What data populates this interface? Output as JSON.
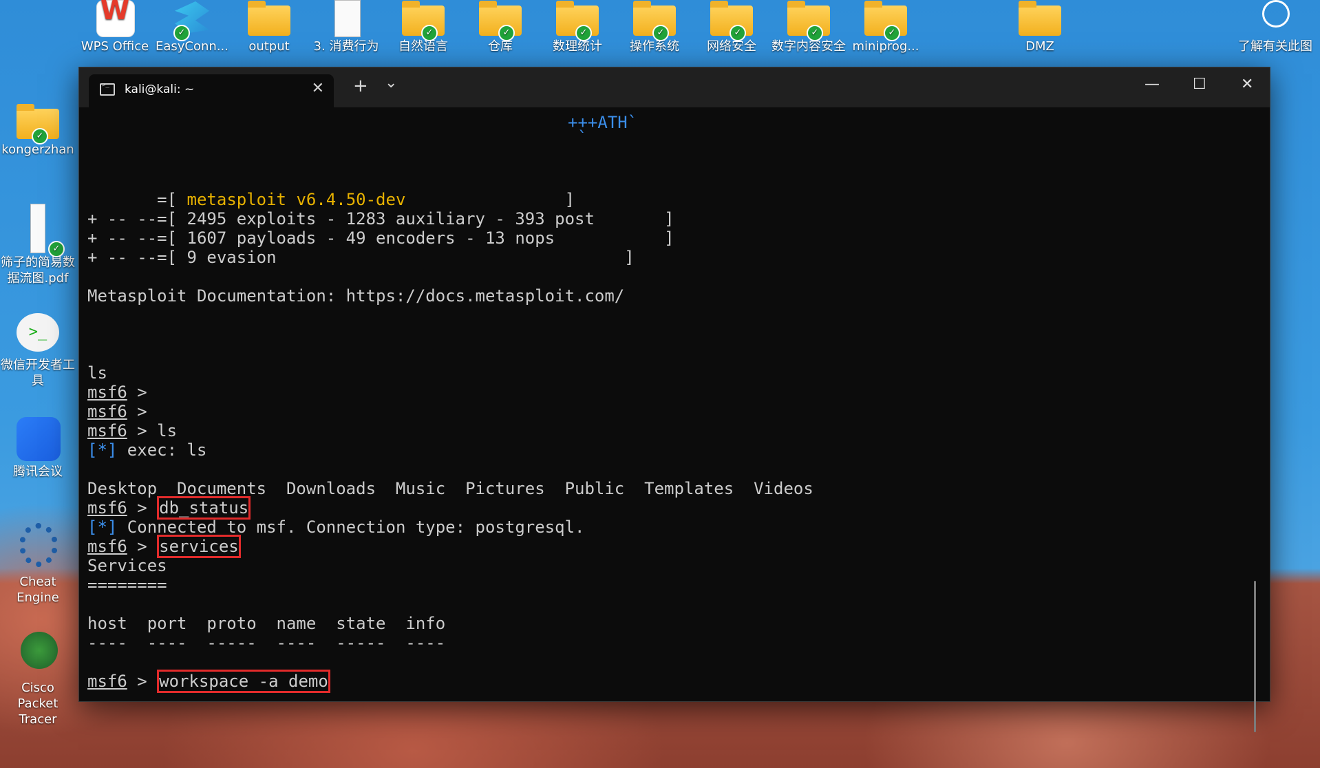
{
  "desktop": {
    "top_icons": [
      {
        "label": "WPS Office",
        "icon": "wps-icon"
      },
      {
        "label": "EasyConn...",
        "icon": "easyconnect-icon"
      },
      {
        "label": "output",
        "icon": "folder-icon"
      },
      {
        "label": "3. 消费行为",
        "icon": "document-icon"
      },
      {
        "label": "自然语言",
        "icon": "folder-icon"
      },
      {
        "label": "仓库",
        "icon": "folder-icon"
      },
      {
        "label": "数理统计",
        "icon": "folder-icon"
      },
      {
        "label": "操作系统",
        "icon": "folder-icon"
      },
      {
        "label": "网络安全",
        "icon": "folder-icon"
      },
      {
        "label": "数字内容安全",
        "icon": "folder-icon"
      },
      {
        "label": "miniprog...",
        "icon": "folder-icon"
      },
      {
        "label": "DMZ",
        "icon": "folder-icon"
      },
      {
        "label": "了解有关此图",
        "icon": "info-icon"
      }
    ],
    "left_icons": [
      {
        "label": "kongerzhan",
        "icon": "folder-icon"
      },
      {
        "label": "筛子的简易数据流图.pdf",
        "icon": "pdf-icon"
      },
      {
        "label": "微信开发者工具",
        "icon": "wechat-devtools-icon"
      },
      {
        "label": "腾讯会议",
        "icon": "tencent-meeting-icon"
      },
      {
        "label": "Cheat Engine",
        "icon": "cheat-engine-icon"
      },
      {
        "label": "Cisco Packet Tracer",
        "icon": "packet-tracer-icon"
      }
    ]
  },
  "terminal": {
    "tab_title": "kali@kali: ~",
    "new_tab_symbol": "+",
    "dropdown_symbol": "⌄",
    "close_symbol": "✕",
    "minimize_symbol": "—",
    "maximize_symbol": "☐",
    "lines": {
      "ascii_art": "+++ATH`",
      "ascii_tick": "`",
      "banner_open": "=[ ",
      "banner_version": "metasploit v6.4.50-dev",
      "banner_close": "]",
      "banner_exploits": "+ -- --=[ 2495 exploits - 1283 auxiliary - 393 post",
      "banner_payloads": "+ -- --=[ 1607 payloads - 49 encoders - 13 nops",
      "banner_evasion": "+ -- --=[ 9 evasion",
      "docs": "Metasploit Documentation: https://docs.metasploit.com/",
      "ls_echo": "ls",
      "prompt": "msf6",
      "prompt_sep": " > ",
      "cmd_ls": "ls",
      "exec_tag": "[*]",
      "exec_text": " exec: ls",
      "ls_output": "Desktop  Documents  Downloads  Music  Pictures  Public  Templates  Videos",
      "cmd_db_status": "db_status",
      "connected_text": " Connected to msf. Connection type: postgresql.",
      "cmd_services": "services",
      "services_title": "Services",
      "services_underline": "========",
      "table_header": "host  port  proto  name  state  info",
      "table_rule": "----  ----  -----  ----  -----  ----",
      "cmd_workspace": "workspace -a demo"
    }
  }
}
